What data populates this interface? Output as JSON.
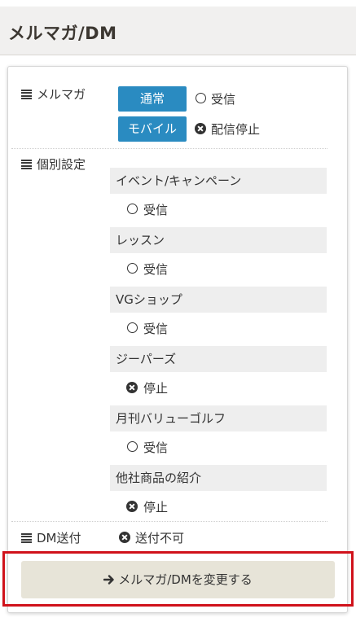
{
  "header": {
    "title": "メルマガ/DM"
  },
  "mailmag": {
    "label": "メルマガ",
    "rows": [
      {
        "button_label": "通常",
        "status_icon": "radio-empty-icon",
        "status": "受信"
      },
      {
        "button_label": "モバイル",
        "status_icon": "circle-x-icon",
        "status": "配信停止"
      }
    ]
  },
  "individual": {
    "label": "個別設定",
    "items": [
      {
        "category": "イベント/キャンペーン",
        "status_icon": "radio-empty-icon",
        "status": "受信"
      },
      {
        "category": "レッスン",
        "status_icon": "radio-empty-icon",
        "status": "受信"
      },
      {
        "category": "VGショップ",
        "status_icon": "radio-empty-icon",
        "status": "受信"
      },
      {
        "category": "ジーパーズ",
        "status_icon": "circle-x-icon",
        "status": "停止"
      },
      {
        "category": "月刊バリューゴルフ",
        "status_icon": "radio-empty-icon",
        "status": "受信"
      },
      {
        "category": "他社商品の紹介",
        "status_icon": "circle-x-icon",
        "status": "停止"
      }
    ]
  },
  "dm": {
    "label": "DM送付",
    "status_icon": "circle-x-icon",
    "status": "送付不可"
  },
  "submit": {
    "label": "メルマガ/DMを変更する",
    "icon": "arrow-right-icon"
  },
  "colors": {
    "accent_blue": "#2a8bc1",
    "highlight_red": "#d0121b",
    "button_beige": "#e7e4d8",
    "header_bg": "#f1f0ef"
  }
}
